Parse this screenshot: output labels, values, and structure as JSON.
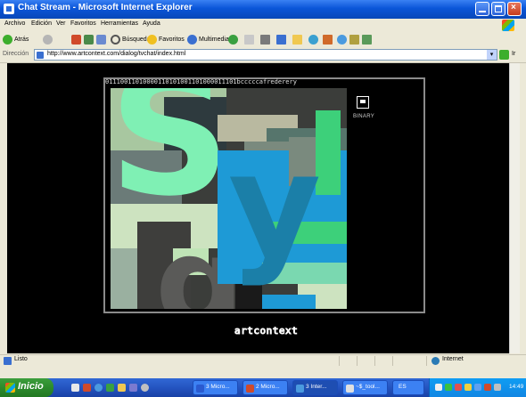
{
  "window": {
    "title": "Chat Stream - Microsoft Internet Explorer"
  },
  "menu": [
    "Archivo",
    "Edición",
    "Ver",
    "Favoritos",
    "Herramientas",
    "Ayuda"
  ],
  "toolbar": {
    "back": "Atrás",
    "search": "Búsqueda",
    "favorites": "Favoritos",
    "media": "Multimedia"
  },
  "address": {
    "label": "Dirección",
    "url": "http://www.artcontext.com/dialog/tvchat/index.html",
    "go": "Ir"
  },
  "content": {
    "binary_string": "01110011010000110101001101000011101bcccccafrederery",
    "binary_label": "BINARY",
    "logo_text": "artcontext"
  },
  "status": {
    "text": "Listo",
    "zone": "Internet"
  },
  "taskbar": {
    "start": "Inicio",
    "tasks": [
      "3 Micro...",
      "2 Micro...",
      "3 Inter...",
      "~$_tool..."
    ],
    "clock": "14:49"
  },
  "colors": {
    "title_blue": "#0a55d8",
    "start_green": "#2c8a2c",
    "art_mint": "#7ff0b4",
    "art_blue": "#1e9ad6",
    "art_green": "#3dd07a",
    "art_olive": "#a29a3c"
  }
}
